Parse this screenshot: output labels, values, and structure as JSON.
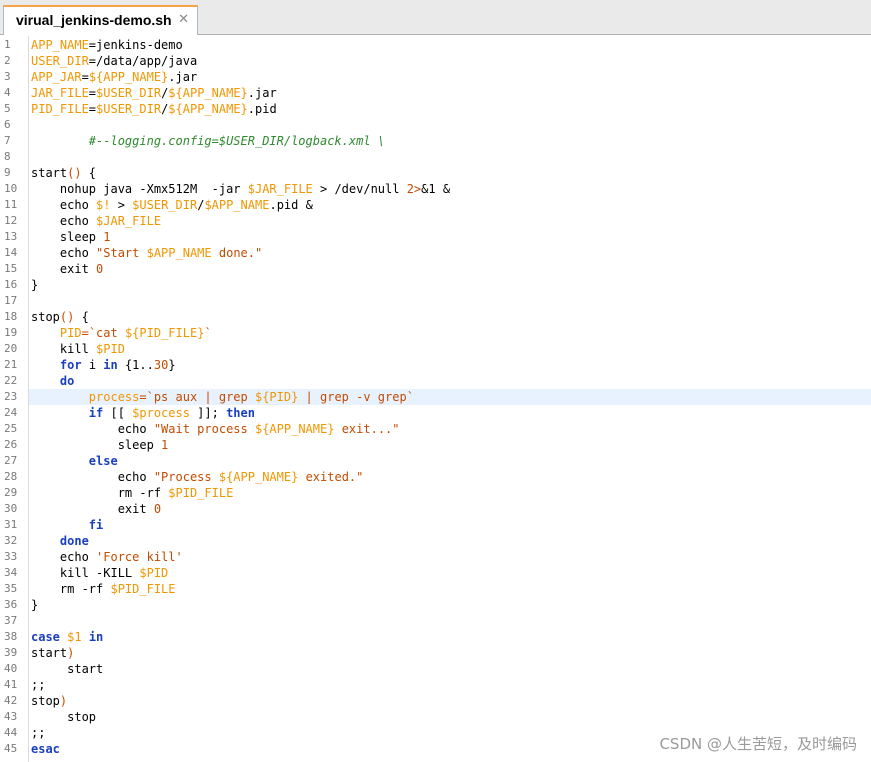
{
  "tab": {
    "title": "virual_jenkins-demo.sh",
    "close_glyph": "✕"
  },
  "current_line": 23,
  "colors": {
    "variable": "#f29600",
    "string": "#c44b00",
    "keyword": "#1a3fbf",
    "comment": "#2f8a2f",
    "plain": "#000000",
    "current_line_bg": "#e8f2fe",
    "tab_accent": "#f7a34a"
  },
  "code_lines": [
    [
      [
        "var",
        "APP_NAME"
      ],
      [
        "pl",
        "=jenkins-demo"
      ]
    ],
    [
      [
        "var",
        "USER_DIR"
      ],
      [
        "pl",
        "=/data/app/java"
      ]
    ],
    [
      [
        "var",
        "APP_JAR"
      ],
      [
        "pl",
        "="
      ],
      [
        "var",
        "${APP_NAME}"
      ],
      [
        "pl",
        ".jar"
      ]
    ],
    [
      [
        "var",
        "JAR_FILE"
      ],
      [
        "pl",
        "="
      ],
      [
        "var",
        "$USER_DIR"
      ],
      [
        "pl",
        "/"
      ],
      [
        "var",
        "${APP_NAME}"
      ],
      [
        "pl",
        ".jar"
      ]
    ],
    [
      [
        "var",
        "PID_FILE"
      ],
      [
        "pl",
        "="
      ],
      [
        "var",
        "$USER_DIR"
      ],
      [
        "pl",
        "/"
      ],
      [
        "var",
        "${APP_NAME}"
      ],
      [
        "pl",
        ".pid"
      ]
    ],
    [],
    [
      [
        "pl",
        "        "
      ],
      [
        "cmt",
        "#--logging.config=$USER_DIR/logback.xml \\"
      ]
    ],
    [],
    [
      [
        "pl",
        "start"
      ],
      [
        "str",
        "()"
      ],
      [
        "pl",
        " {"
      ]
    ],
    [
      [
        "pl",
        "    nohup java -Xmx512M  -jar "
      ],
      [
        "var",
        "$JAR_FILE"
      ],
      [
        "pl",
        " > /dev/null "
      ],
      [
        "str",
        "2>"
      ],
      [
        "pl",
        "&1 &"
      ]
    ],
    [
      [
        "pl",
        "    echo "
      ],
      [
        "var",
        "$!"
      ],
      [
        "pl",
        " > "
      ],
      [
        "var",
        "$USER_DIR"
      ],
      [
        "pl",
        "/"
      ],
      [
        "var",
        "$APP_NAME"
      ],
      [
        "pl",
        ".pid &"
      ]
    ],
    [
      [
        "pl",
        "    echo "
      ],
      [
        "var",
        "$JAR_FILE"
      ]
    ],
    [
      [
        "pl",
        "    sleep "
      ],
      [
        "num",
        "1"
      ]
    ],
    [
      [
        "pl",
        "    echo "
      ],
      [
        "str",
        "\"Start "
      ],
      [
        "var",
        "$APP_NAME"
      ],
      [
        "str",
        " done.\""
      ]
    ],
    [
      [
        "pl",
        "    exit "
      ],
      [
        "num",
        "0"
      ]
    ],
    [
      [
        "pl",
        "}"
      ]
    ],
    [],
    [
      [
        "pl",
        "stop"
      ],
      [
        "str",
        "()"
      ],
      [
        "pl",
        " {"
      ]
    ],
    [
      [
        "pl",
        "    "
      ],
      [
        "var",
        "PID"
      ],
      [
        "str",
        "=`cat "
      ],
      [
        "var",
        "${PID_FILE}"
      ],
      [
        "str",
        "`"
      ]
    ],
    [
      [
        "pl",
        "    kill "
      ],
      [
        "var",
        "$PID"
      ]
    ],
    [
      [
        "pl",
        "    "
      ],
      [
        "kw",
        "for"
      ],
      [
        "pl",
        " i "
      ],
      [
        "kw",
        "in"
      ],
      [
        "pl",
        " {1.."
      ],
      [
        "num",
        "30"
      ],
      [
        "pl",
        "}"
      ]
    ],
    [
      [
        "pl",
        "    "
      ],
      [
        "kw",
        "do"
      ]
    ],
    [
      [
        "pl",
        "        "
      ],
      [
        "var",
        "process"
      ],
      [
        "str",
        "=`ps aux | grep "
      ],
      [
        "var",
        "${PID}"
      ],
      [
        "str",
        " | grep -v grep`"
      ]
    ],
    [
      [
        "pl",
        "        "
      ],
      [
        "kw",
        "if"
      ],
      [
        "pl",
        " [[ "
      ],
      [
        "var",
        "$process"
      ],
      [
        "pl",
        " ]]; "
      ],
      [
        "kw",
        "then"
      ]
    ],
    [
      [
        "pl",
        "            echo "
      ],
      [
        "str",
        "\"Wait process "
      ],
      [
        "var",
        "${APP_NAME}"
      ],
      [
        "str",
        " exit...\""
      ]
    ],
    [
      [
        "pl",
        "            sleep "
      ],
      [
        "num",
        "1"
      ]
    ],
    [
      [
        "pl",
        "        "
      ],
      [
        "kw",
        "else"
      ]
    ],
    [
      [
        "pl",
        "            echo "
      ],
      [
        "str",
        "\"Process "
      ],
      [
        "var",
        "${APP_NAME}"
      ],
      [
        "str",
        " exited.\""
      ]
    ],
    [
      [
        "pl",
        "            rm -rf "
      ],
      [
        "var",
        "$PID_FILE"
      ]
    ],
    [
      [
        "pl",
        "            exit "
      ],
      [
        "num",
        "0"
      ]
    ],
    [
      [
        "pl",
        "        "
      ],
      [
        "kw",
        "fi"
      ]
    ],
    [
      [
        "pl",
        "    "
      ],
      [
        "kw",
        "done"
      ]
    ],
    [
      [
        "pl",
        "    echo "
      ],
      [
        "str",
        "'Force kill'"
      ]
    ],
    [
      [
        "pl",
        "    kill -KILL "
      ],
      [
        "var",
        "$PID"
      ]
    ],
    [
      [
        "pl",
        "    rm -rf "
      ],
      [
        "var",
        "$PID_FILE"
      ]
    ],
    [
      [
        "pl",
        "}"
      ]
    ],
    [],
    [
      [
        "kw",
        "case"
      ],
      [
        "pl",
        " "
      ],
      [
        "var",
        "$1"
      ],
      [
        "pl",
        " "
      ],
      [
        "kw",
        "in"
      ]
    ],
    [
      [
        "pl",
        "start"
      ],
      [
        "str",
        ")"
      ]
    ],
    [
      [
        "pl",
        "     start"
      ]
    ],
    [
      [
        "pl",
        ";;"
      ]
    ],
    [
      [
        "pl",
        "stop"
      ],
      [
        "str",
        ")"
      ]
    ],
    [
      [
        "pl",
        "     stop"
      ]
    ],
    [
      [
        "pl",
        ";;"
      ]
    ],
    [
      [
        "kw",
        "esac"
      ]
    ]
  ],
  "watermark": "CSDN @人生苦短，及时编码"
}
